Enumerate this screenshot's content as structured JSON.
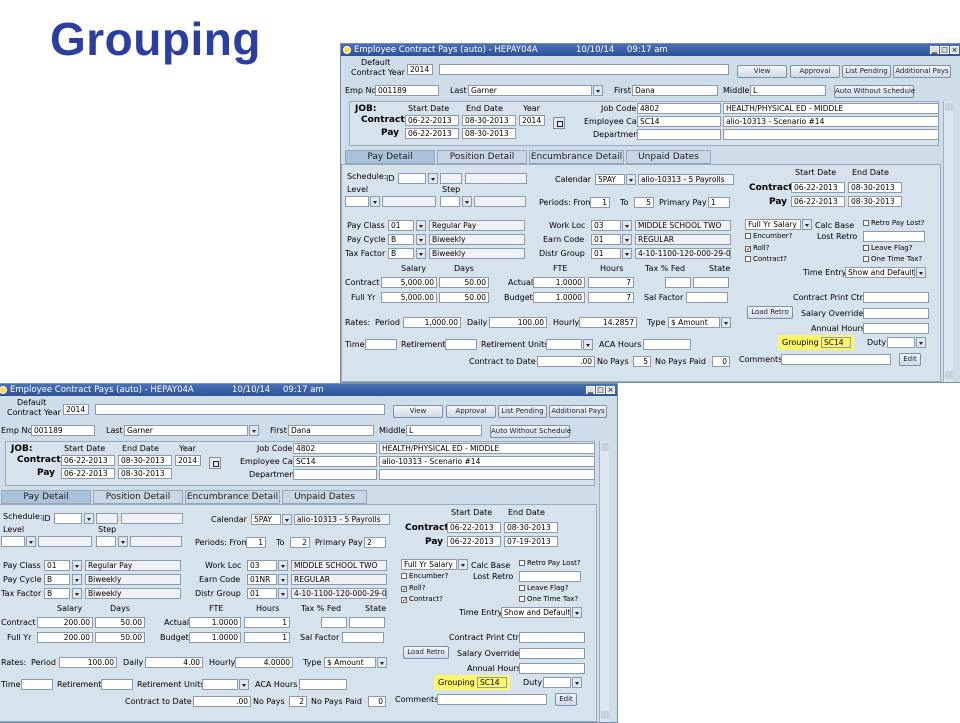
{
  "slide_title": "Grouping",
  "colors": {
    "title": "#2b3fa0",
    "titlebar": "#2f5296",
    "highlight": "#fff56a",
    "panel": "#d6e2ec"
  },
  "windows": [
    {
      "title": "Employee Contract Pays (auto) - HEPAY04A",
      "date": "10/10/14",
      "time": "09:17 am",
      "labels": {
        "default_contract_year": "Default\nContract Year",
        "emp_no": "Emp No",
        "last": "Last",
        "first": "First",
        "middle": "Middle",
        "job": "JOB:",
        "start_date": "Start Date",
        "end_date": "End Date",
        "year": "Year",
        "contract": "Contract",
        "pay": "Pay",
        "job_code": "Job Code",
        "employee_cat": "Employee Cat",
        "department": "Department",
        "schedule": "Schedule:",
        "id": "ID",
        "level": "Level",
        "step": "Step",
        "calendar": "Calendar",
        "periods_from": "Periods: From",
        "to": "To",
        "primary_pay": "Primary Pay",
        "pay_class": "Pay Class",
        "pay_cycle": "Pay Cycle",
        "tax_factor": "Tax Factor",
        "work_loc": "Work Loc",
        "earn_code": "Earn Code",
        "distr_group": "Distr Group",
        "salary": "Salary",
        "days": "Days",
        "fte": "FTE",
        "hours": "Hours",
        "tax_pct_fed": "Tax % Fed",
        "state": "State",
        "actual": "Actual",
        "budget": "Budget",
        "full_yr": "Full Yr",
        "sal_factor": "Sal Factor",
        "rates": "Rates:",
        "period": "Period",
        "daily": "Daily",
        "hourly": "Hourly",
        "type": "Type",
        "time": "Time",
        "retirement": "Retirement",
        "retirement_units": "Retirement Units",
        "aca_hours": "ACA Hours",
        "contract_to_date": "Contract to Date",
        "no_pays": "No Pays",
        "no_pays_paid": "No Pays Paid",
        "calc_base": "Calc Base",
        "lost_retro": "Lost Retro",
        "time_entry": "Time Entry",
        "contract_print_ctrl": "Contract Print Ctrl",
        "salary_override": "Salary Override",
        "annual_hours": "Annual Hours",
        "grouping": "Grouping",
        "duty": "Duty",
        "comments": "Comments"
      },
      "buttons": {
        "view": "View",
        "approval": "Approval",
        "list_pending": "List Pending",
        "additional_pays": "Additional Pays",
        "auto_without_schedule": "Auto Without Schedule",
        "load_retro": "Load Retro",
        "edit": "Edit"
      },
      "tabs": [
        "Pay Detail",
        "Position Detail",
        "Encumbrance Detail",
        "Unpaid Dates"
      ],
      "checkboxes": {
        "retro_pay_lost": "Retro Pay Lost?",
        "encumber": "Encumber?",
        "roll": "Roll?",
        "contract": "Contract?",
        "leave_flag": "Leave Flag?",
        "one_time_tax": "One Time Tax?"
      },
      "values": {
        "contract_year": "2014",
        "emp_no": "001189",
        "last": "Garner",
        "first": "Dana",
        "middle": "L",
        "contract_start": "06-22-2013",
        "contract_end": "08-30-2013",
        "contract_year2": "2014",
        "pay_start": "06-22-2013",
        "pay_end": "08-30-2013",
        "job_code": "4802",
        "job_desc": "HEALTH/PHYSICAL ED - MIDDLE",
        "employee_cat": "SC14",
        "employee_cat_desc": "alio-10313 - Scenario #14",
        "calendar": "5PAY",
        "calendar_desc": "alio-10313 - 5 Payrolls",
        "period_from": "1",
        "period_to": "5",
        "primary_pay": "1",
        "pay_class": "01",
        "pay_class_desc": "Regular Pay",
        "pay_cycle": "B",
        "pay_cycle_desc": "Biweekly",
        "tax_factor": "B",
        "tax_factor_desc": "Biweekly",
        "work_loc": "03",
        "work_loc_desc": "MIDDLE SCHOOL TWO",
        "earn_code": "01",
        "earn_code_desc": "REGULAR",
        "distr_group": "01",
        "distr_group_desc": "4-10-1100-120-000-29-03",
        "contract_salary": "5,000.00",
        "contract_days": "50.00",
        "full_yr_salary": "5,000.00",
        "full_yr_days": "50.00",
        "actual_fte": "1.0000",
        "actual_hours": "7",
        "budget_fte": "1.0000",
        "budget_hours": "7",
        "rate_period": "1,000.00",
        "rate_daily": "100.00",
        "rate_hourly": "14.2857",
        "type": "$ Amount",
        "contract_to_date": ".00",
        "no_pays": "5",
        "no_pays_paid": "0",
        "right_contract_start": "06-22-2013",
        "right_contract_end": "08-30-2013",
        "right_pay_start": "06-22-2013",
        "right_pay_end": "08-30-2013",
        "calc_base": "Full Yr Salary",
        "time_entry": "Show and Default",
        "grouping": "SC14",
        "roll_checked": true,
        "contract_checked": false
      }
    },
    {
      "title": "Employee Contract Pays (auto) - HEPAY04A",
      "date": "10/10/14",
      "time": "09:17 am",
      "values": {
        "contract_year": "2014",
        "emp_no": "001189",
        "last": "Garner",
        "first": "Dana",
        "middle": "L",
        "contract_start": "06-22-2013",
        "contract_end": "08-30-2013",
        "contract_year2": "2014",
        "pay_start": "06-22-2013",
        "pay_end": "08-30-2013",
        "job_code": "4802",
        "job_desc": "HEALTH/PHYSICAL ED - MIDDLE",
        "employee_cat": "SC14",
        "employee_cat_desc": "alio-10313 - Scenario #14",
        "calendar": "5PAY",
        "calendar_desc": "alio-10313 - 5 Payrolls",
        "period_from": "1",
        "period_to": "2",
        "primary_pay": "2",
        "pay_class": "01",
        "pay_class_desc": "Regular Pay",
        "pay_cycle": "B",
        "pay_cycle_desc": "Biweekly",
        "tax_factor": "B",
        "tax_factor_desc": "Biweekly",
        "work_loc": "03",
        "work_loc_desc": "MIDDLE SCHOOL TWO",
        "earn_code": "01NR",
        "earn_code_desc": "REGULAR",
        "distr_group": "01",
        "distr_group_desc": "4-10-1100-120-000-29-03",
        "contract_salary": "200.00",
        "contract_days": "50.00",
        "full_yr_salary": "200.00",
        "full_yr_days": "50.00",
        "actual_fte": "1.0000",
        "actual_hours": "1",
        "budget_fte": "1.0000",
        "budget_hours": "1",
        "rate_period": "100.00",
        "rate_daily": "4.00",
        "rate_hourly": "4.0000",
        "type": "$ Amount",
        "contract_to_date": ".00",
        "no_pays": "2",
        "no_pays_paid": "0",
        "right_contract_start": "06-22-2013",
        "right_contract_end": "08-30-2013",
        "right_pay_start": "06-22-2013",
        "right_pay_end": "07-19-2013",
        "calc_base": "Full Yr Salary",
        "time_entry": "Show and Default",
        "grouping": "SC14",
        "roll_checked": true,
        "contract_checked": true
      }
    }
  ]
}
